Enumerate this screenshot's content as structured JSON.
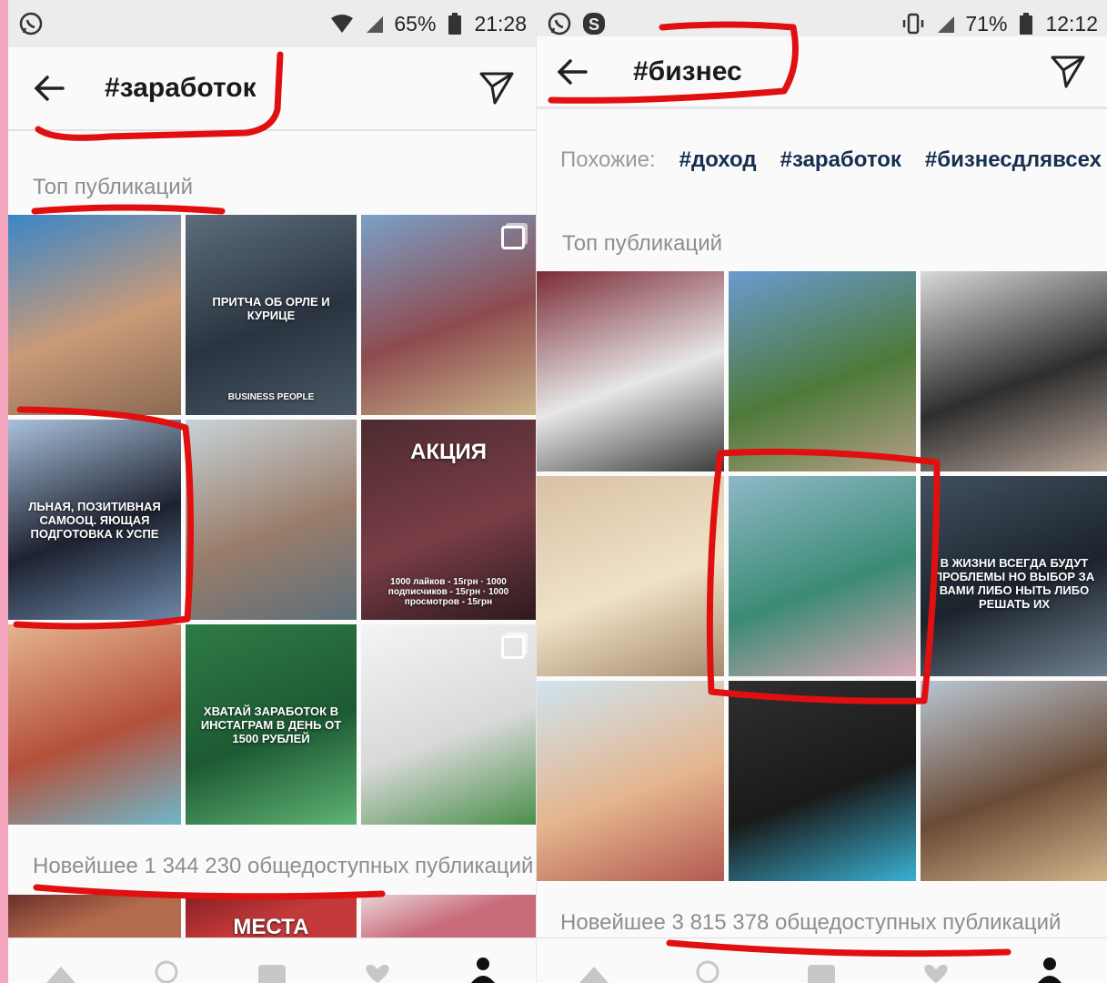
{
  "left_screen": {
    "status": {
      "battery": "65%",
      "time": "21:28"
    },
    "header": {
      "title": "#заработок"
    },
    "top_label": "Топ публикаций",
    "tiles": [
      {
        "caption": "",
        "colors": [
          "#3a86c8",
          "#c99a78",
          "#8a6a52"
        ]
      },
      {
        "caption": "ПРИТЧА ОБ ОРЛЕ И КУРИЦЕ",
        "sub": "BUSINESS PEOPLE",
        "colors": [
          "#5d6d7c",
          "#2a3440",
          "#4a5866"
        ]
      },
      {
        "caption": "",
        "colors": [
          "#7aa0c8",
          "#8e4b4f",
          "#c9b48a"
        ],
        "multi": true
      },
      {
        "caption": "ЛЬНАЯ, ПОЗИТИВНАЯ САМООЦ. ЯЮЩАЯ ПОДГОТОВКА К УСПЕ",
        "colors": [
          "#a9c1dc",
          "#1e2230",
          "#6b87a8"
        ]
      },
      {
        "caption": "",
        "colors": [
          "#c7d3d8",
          "#9a7d6a",
          "#5d6f7a"
        ]
      },
      {
        "caption": "АКЦИЯ",
        "sub": "1000 лайков - 15грн · 1000 подписчиков - 15грн · 1000 просмотров - 15грн",
        "colors": [
          "#4c2b30",
          "#7a3d46",
          "#2c1a1e"
        ]
      },
      {
        "caption": "",
        "colors": [
          "#e5b48f",
          "#b4503b",
          "#6fb7c9"
        ]
      },
      {
        "caption": "ХВАТАЙ ЗАРАБОТОК В ИНСТАГРАМ В ДЕНЬ ОТ 1500 РУБЛЕЙ",
        "colors": [
          "#2e7b45",
          "#1d5a33",
          "#5fb374"
        ]
      },
      {
        "caption": "",
        "colors": [
          "#f4f4f4",
          "#d9d9d9",
          "#4a8f4a"
        ],
        "multi": true
      }
    ],
    "newest": {
      "label": "Новейшее",
      "count": "1 344 230 общедоступных публикаций"
    },
    "strip": [
      {
        "caption": "",
        "colors": [
          "#6a2f2a",
          "#b46b4d"
        ]
      },
      {
        "caption": "МЕСТА",
        "colors": [
          "#8a1f24",
          "#c43a3a"
        ]
      },
      {
        "caption": "",
        "colors": [
          "#e9d6d8",
          "#c96b7a"
        ]
      }
    ]
  },
  "right_screen": {
    "status": {
      "battery": "71%",
      "time": "12:12"
    },
    "header": {
      "title": "#бизнес"
    },
    "similar": {
      "label": "Похожие:",
      "tags": [
        "#доход",
        "#заработок",
        "#бизнесдлявсех"
      ]
    },
    "top_label": "Топ публикаций",
    "tiles": [
      {
        "caption": "",
        "colors": [
          "#7b2b36",
          "#e7e7e7",
          "#3a3a3a"
        ]
      },
      {
        "caption": "",
        "colors": [
          "#6b9ad1",
          "#4d7a3a",
          "#b59f86"
        ]
      },
      {
        "caption": "",
        "colors": [
          "#d9d9d9",
          "#2e2e2e",
          "#b9a79a"
        ]
      },
      {
        "caption": "",
        "colors": [
          "#d8c1a6",
          "#f0e2c7",
          "#a78c6e"
        ]
      },
      {
        "caption": "",
        "colors": [
          "#8fb8c7",
          "#3b8b75",
          "#d9a6b4"
        ]
      },
      {
        "caption": "В ЖИЗНИ ВСЕГДА БУДУТ ПРОБЛЕМЫ НО ВЫБОР ЗА ВАМИ ЛИБО НЫТЬ ЛИБО РЕШАТЬ ИХ",
        "colors": [
          "#41505e",
          "#1b232c",
          "#6f7f8d"
        ]
      },
      {
        "caption": "",
        "colors": [
          "#cfe4ee",
          "#e4b58e",
          "#b35a50"
        ]
      },
      {
        "caption": "",
        "colors": [
          "#2f2f2f",
          "#1a1a1a",
          "#3ab0d2"
        ]
      },
      {
        "caption": "",
        "colors": [
          "#b9c6d2",
          "#6a4b36",
          "#d1b38a"
        ]
      }
    ],
    "newest": {
      "label": "Новейшее",
      "count": "3 815 378 общедоступных публикаций"
    }
  },
  "annotation_color": "#e01010"
}
